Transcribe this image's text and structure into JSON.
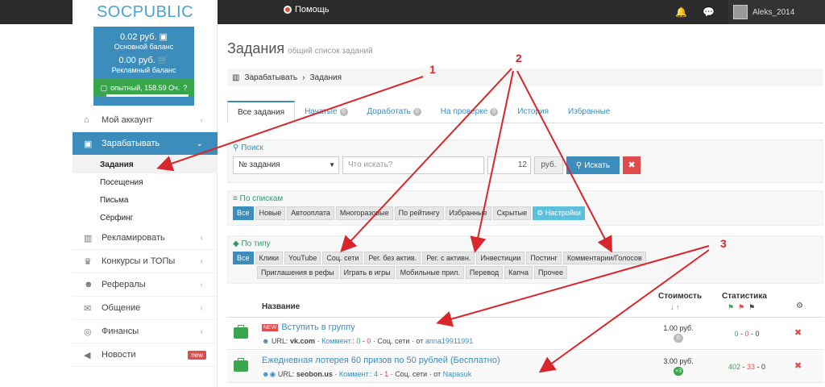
{
  "topbar": {
    "logo_a": "SOC",
    "logo_b": "PUBLIC",
    "help": "Помощь",
    "bell_icon": "bell-icon",
    "chat_icon": "chat-icon",
    "username": "Aleks_2014"
  },
  "balance": {
    "main_amount": "0.02 руб.",
    "main_label": "Основной баланс",
    "ad_amount": "0.00 руб.",
    "ad_label": "Рекламный баланс",
    "experience": "опытный, 158.59 Оч."
  },
  "sidebar": {
    "items": [
      {
        "label": "Мой аккаунт"
      },
      {
        "label": "Зарабатывать"
      },
      {
        "label": "Рекламировать"
      },
      {
        "label": "Конкурсы и ТОПы"
      },
      {
        "label": "Рефералы"
      },
      {
        "label": "Общение"
      },
      {
        "label": "Финансы"
      },
      {
        "label": "Новости",
        "badge": "new"
      }
    ],
    "sub": [
      "Задания",
      "Посещения",
      "Письма",
      "Сёрфинг"
    ]
  },
  "page": {
    "title": "Задания",
    "subtitle": "общий список заданий",
    "crumb1": "Зарабатывать",
    "crumb2": "Задания"
  },
  "tabs": [
    {
      "label": "Все задания"
    },
    {
      "label": "Начатые",
      "count": "0"
    },
    {
      "label": "Доработать",
      "count": "0"
    },
    {
      "label": "На проверке",
      "count": "0"
    },
    {
      "label": "История"
    },
    {
      "label": "Избранные"
    }
  ],
  "search": {
    "heading": "Поиск",
    "select_value": "№ задания",
    "placeholder": "Что искать?",
    "amount": "12",
    "unit": "руб.",
    "button": "Искать",
    "clear": "✖"
  },
  "lists": {
    "heading": "По спискам",
    "chips": [
      "Все",
      "Новые",
      "Автооплата",
      "Многоразовые",
      "По рейтингу",
      "Избранные",
      "Скрытые"
    ],
    "settings": "Настройки"
  },
  "types": {
    "heading": "По типу",
    "chips": [
      "Все",
      "Клики",
      "YouTube",
      "Соц. сети",
      "Рег. без актив.",
      "Рег. с активн.",
      "Инвестиции",
      "Постинг",
      "Комментарии/Голосов",
      "Приглашения в рефы",
      "Играть в игры",
      "Мобильные прил.",
      "Перевод",
      "Капча",
      "Прочее"
    ]
  },
  "table": {
    "col_name": "Название",
    "col_cost": "Стоимость",
    "col_stats": "Статистика",
    "rows": [
      {
        "new_badge": "NEW",
        "title": "Вступить в группу",
        "url_label": "URL:",
        "url": "vk.com",
        "comments_label": "Коммент.:",
        "c_plus": "0",
        "c_minus": "0",
        "category": "Соц. сети",
        "from_label": "от",
        "author": "anna19911991",
        "price": "1.00 руб.",
        "price_badge": "0",
        "stat_ok": "0",
        "stat_bad": "0",
        "stat_wait": "0"
      },
      {
        "title": "Ежедневная лотерея 60 призов по 50 рублей (Бесплатно)",
        "url_label": "URL:",
        "url": "seobon.us",
        "comments_label": "Коммент.:",
        "c_plus": "4",
        "c_minus": "1",
        "category": "Соц. сети",
        "from_label": "от",
        "author": "Napasuk",
        "price": "3.00 руб.",
        "price_badge": "+3",
        "stat_ok": "402",
        "stat_bad": "33",
        "stat_wait": "0"
      }
    ]
  },
  "annotations": {
    "n1": "1",
    "n2": "2",
    "n3": "3"
  },
  "colors": {
    "accent": "#3c8dbc",
    "success": "#3aa64c",
    "danger": "#e04b4b",
    "arrow": "#d8262a"
  }
}
